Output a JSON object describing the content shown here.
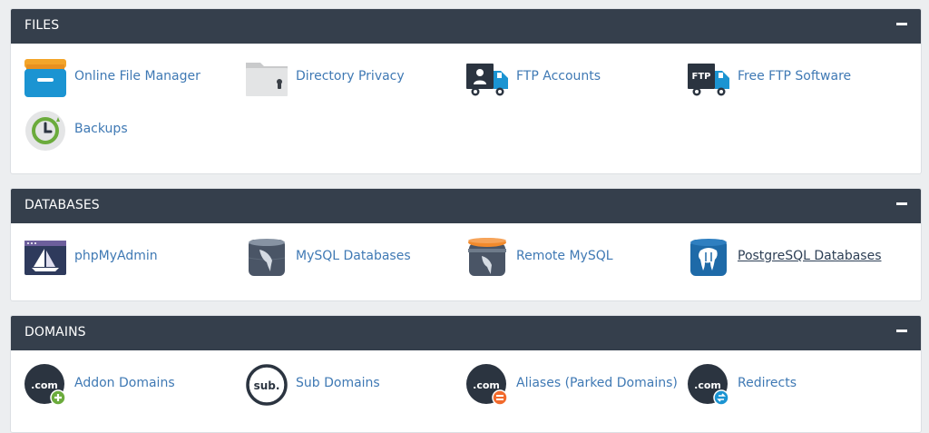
{
  "sections": {
    "files": {
      "title": "FILES",
      "items": [
        {
          "label": "Online File Manager"
        },
        {
          "label": "Directory Privacy"
        },
        {
          "label": "FTP Accounts"
        },
        {
          "label": "Free FTP Software"
        },
        {
          "label": "Backups"
        }
      ]
    },
    "databases": {
      "title": "DATABASES",
      "items": [
        {
          "label": "phpMyAdmin"
        },
        {
          "label": "MySQL Databases"
        },
        {
          "label": "Remote MySQL"
        },
        {
          "label": "PostgreSQL Databases"
        }
      ]
    },
    "domains": {
      "title": "DOMAINS",
      "items": [
        {
          "label": "Addon Domains"
        },
        {
          "label": "Sub Domains"
        },
        {
          "label": "Aliases (Parked Domains)"
        },
        {
          "label": "Redirects"
        }
      ]
    }
  },
  "icons": {
    "ftp_text": "FTP",
    "com_text": ".com",
    "sub_text": "sub."
  },
  "colors": {
    "header_bg": "#353f4c",
    "link": "#3f79b4",
    "page_bg": "#eceef0"
  }
}
